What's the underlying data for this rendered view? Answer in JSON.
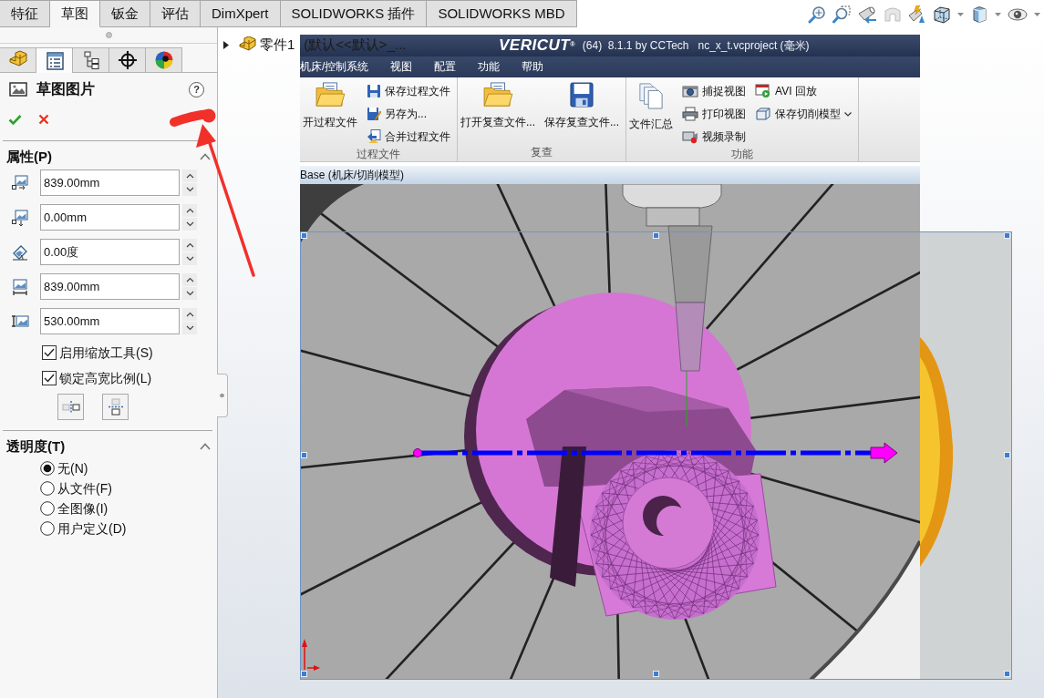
{
  "command_tabs": [
    {
      "label": "特征",
      "selected": false
    },
    {
      "label": "草图",
      "selected": true
    },
    {
      "label": "钣金",
      "selected": false
    },
    {
      "label": "评估",
      "selected": false
    },
    {
      "label": "DimXpert",
      "selected": false
    },
    {
      "label": "SOLIDWORKS 插件",
      "selected": false
    },
    {
      "label": "SOLIDWORKS MBD",
      "selected": false
    }
  ],
  "property_manager": {
    "panel_tabs": [
      {
        "selected": false
      },
      {
        "selected": true
      },
      {
        "selected": false
      },
      {
        "selected": false
      },
      {
        "selected": false
      }
    ],
    "title": "草图图片",
    "help": "?",
    "properties": {
      "heading": "属性(P)",
      "expanded": true,
      "fields": [
        {
          "value": "839.00mm"
        },
        {
          "value": "0.00mm"
        },
        {
          "value": "0.00度"
        },
        {
          "value": "839.00mm"
        },
        {
          "value": "530.00mm"
        }
      ],
      "options": [
        {
          "label": "启用缩放工具(S)",
          "checked": true
        },
        {
          "label": "锁定高宽比例(L)",
          "checked": true
        }
      ]
    },
    "transparency": {
      "heading": "透明度(T)",
      "expanded": true,
      "options": [
        {
          "label": "无(N)",
          "selected": true
        },
        {
          "label": "从文件(F)",
          "selected": false
        },
        {
          "label": "全图像(I)",
          "selected": false
        },
        {
          "label": "用户定义(D)",
          "selected": false
        }
      ]
    }
  },
  "feature_tree": {
    "items": [
      {
        "name": "零件1",
        "configuration": "(默认<<默认>_...",
        "expanded": false
      }
    ]
  },
  "sketch_picture": {
    "selected": true,
    "app_window": {
      "logo": "VERICUT$^{®}$",
      "title": "(64)  8.1.1 by CCTech   nc_x_t.vcproject (毫米)",
      "menu": [
        "机床/控制系统",
        "视图",
        "配置",
        "功能",
        "帮助"
      ],
      "ribbon": [
        {
          "label": "过程文件",
          "buttons": [
            {
              "kind": "large",
              "label": "开过程文件"
            },
            {
              "kind": "small",
              "label": "保存过程文件"
            },
            {
              "kind": "small",
              "label": "另存为..."
            },
            {
              "kind": "small",
              "label": "合并过程文件"
            }
          ]
        },
        {
          "label": "复查",
          "buttons": [
            {
              "kind": "large",
              "label": "打开复查文件..."
            },
            {
              "kind": "large",
              "label": "保存复查文件..."
            }
          ]
        },
        {
          "label": "功能",
          "buttons": [
            {
              "kind": "large",
              "label": "文件汇总"
            },
            {
              "kind": "small",
              "label": "捕捉视图"
            },
            {
              "kind": "small",
              "label": "打印视图"
            },
            {
              "kind": "small",
              "label": "视频录制"
            },
            {
              "kind": "small",
              "label": "AVI 回放"
            },
            {
              "kind": "split",
              "label": "保存切削模型"
            }
          ]
        }
      ],
      "view_title": "Base (机床/切削模型)"
    }
  }
}
